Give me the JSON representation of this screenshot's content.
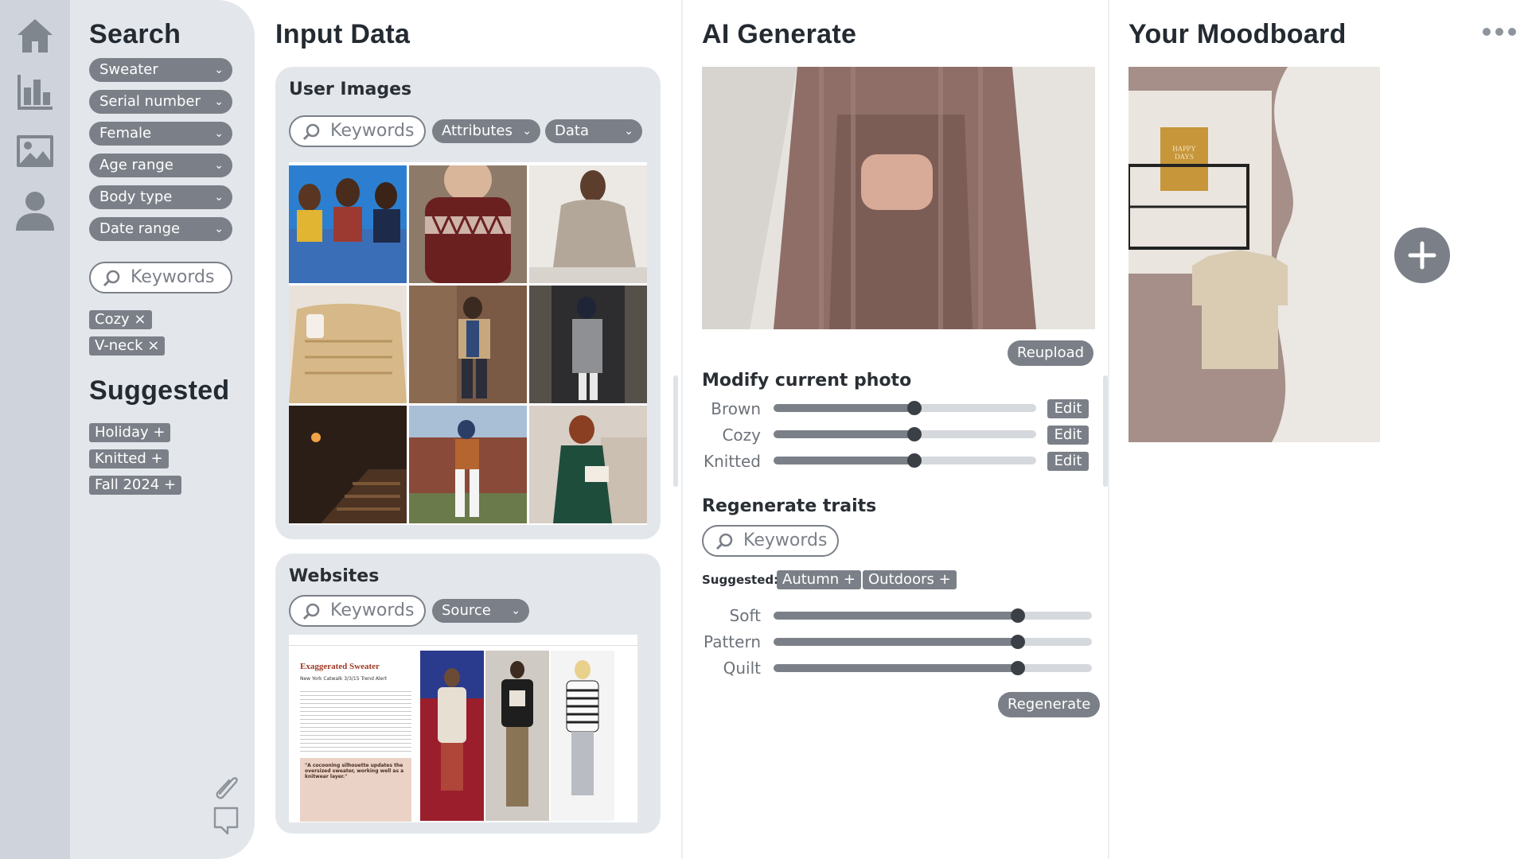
{
  "colors": {
    "rail": "#cfd4dc",
    "panel": "#e3e7ec",
    "control": "#7b8088",
    "text": "#242a31",
    "knob": "#3b4047"
  },
  "nav": {
    "items": [
      "home-icon",
      "chart-icon",
      "image-icon",
      "user-icon"
    ]
  },
  "search": {
    "title": "Search",
    "filters": [
      "Sweater",
      "Serial number",
      "Female",
      "Age range",
      "Body type",
      "Date range"
    ],
    "keywords_placeholder": "Keywords",
    "active_tags": [
      "Cozy ×",
      "V-neck ×"
    ],
    "suggested_title": "Suggested",
    "suggested_tags": [
      "Holiday +",
      "Knitted +",
      "Fall 2024 +"
    ]
  },
  "input_data": {
    "title": "Input Data",
    "user_images": {
      "title": "User Images",
      "keywords_placeholder": "Keywords",
      "attributes_label": "Attributes",
      "data_label": "Data"
    },
    "websites": {
      "title": "Websites",
      "keywords_placeholder": "Keywords",
      "source_label": "Source",
      "article": {
        "headline": "Exaggerated Sweater",
        "kicker": "New York Catwalk 3/3/15 Trend Alert",
        "quote": "\"A cocooning silhouette updates the oversized sweater, working well as a knitwear layer.\""
      }
    }
  },
  "ai_generate": {
    "title": "AI Generate",
    "reupload_label": "Reupload",
    "modify_title": "Modify current photo",
    "modify_sliders": [
      {
        "label": "Brown",
        "value": 0.53,
        "edit": "Edit"
      },
      {
        "label": "Cozy",
        "value": 0.53,
        "edit": "Edit"
      },
      {
        "label": "Knitted",
        "value": 0.53,
        "edit": "Edit"
      }
    ],
    "regenerate_title": "Regenerate traits",
    "keywords_placeholder": "Keywords",
    "suggested_label": "Suggested:",
    "suggested_tags": [
      "Autumn +",
      "Outdoors +"
    ],
    "trait_sliders": [
      {
        "label": "Soft",
        "value": 0.76
      },
      {
        "label": "Pattern",
        "value": 0.76
      },
      {
        "label": "Quilt",
        "value": 0.76
      }
    ],
    "regenerate_label": "Regenerate"
  },
  "moodboard": {
    "title": "Your Moodboard",
    "more_icon": "more-dots-icon",
    "add_icon": "plus-icon",
    "card_text": "HAPPY DAYS"
  },
  "footer_icons": [
    "paperclip-icon",
    "comment-icon"
  ]
}
